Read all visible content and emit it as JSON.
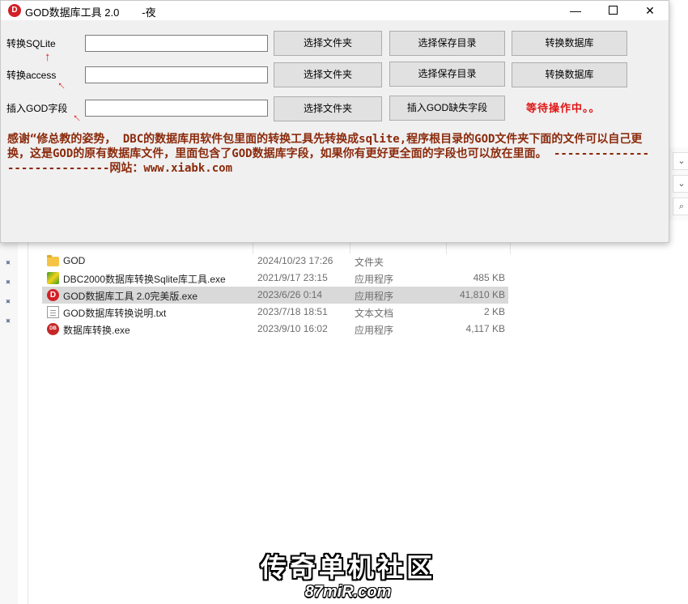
{
  "window": {
    "title": "GOD数据库工具 2.0",
    "title_suffix": "-夜",
    "app_icon": "D",
    "minimize_glyph": "—",
    "close_glyph": "✕"
  },
  "rows": {
    "sqlite": {
      "label": "转换SQLite",
      "input_value": "",
      "btn_folder": "选择文件夹",
      "btn_save": "选择保存目录",
      "btn_convert": "转换数据库"
    },
    "access": {
      "label": "转换access",
      "input_value": "",
      "btn_folder": "选择文件夹",
      "btn_save": "选择保存目录",
      "btn_convert": "转换数据库"
    },
    "god": {
      "label": "插入GOD字段",
      "input_value": "",
      "btn_folder": "选择文件夹",
      "btn_insert": "插入GOD缺失字段"
    }
  },
  "status_text": "等待操作中。。",
  "description": "感谢“修总教的姿势， DBC的数据库用软件包里面的转换工具先转换成sqlite,程序根目录的GOD文件夹下面的文件可以自己更换，这是GOD的原有数据库文件，里面包含了GOD数据库字段，如果你有更好更全面的字段也可以放在里面。 -----------------------------网站：www.xiabk.com",
  "explorer": {
    "files": [
      {
        "name": "GOD",
        "date": "2024/10/23 17:26",
        "type": "文件夹",
        "size": "",
        "icon": "folder-icon"
      },
      {
        "name": "DBC2000数据库转换Sqlite库工具.exe",
        "date": "2021/9/17 23:15",
        "type": "应用程序",
        "size": "485 KB",
        "icon": "dbc-exe-icon"
      },
      {
        "name": "GOD数据库工具 2.0完美版.exe",
        "date": "2023/6/26 0:14",
        "type": "应用程序",
        "size": "41,810 KB",
        "icon": "god-exe-icon"
      },
      {
        "name": "GOD数据库转换说明.txt",
        "date": "2023/7/18 18:51",
        "type": "文本文档",
        "size": "2 KB",
        "icon": "text-file-icon"
      },
      {
        "name": "数据库转换.exe",
        "date": "2023/9/10 16:02",
        "type": "应用程序",
        "size": "4,117 KB",
        "icon": "db-convert-exe-icon"
      }
    ],
    "selected_index": 2
  },
  "watermark": {
    "title": "传奇单机社区",
    "url": "87miR.com"
  },
  "colors": {
    "status": "#e01515",
    "description": "#8b2a0c",
    "arrow": "#e02020",
    "app_icon": "#d32027"
  }
}
